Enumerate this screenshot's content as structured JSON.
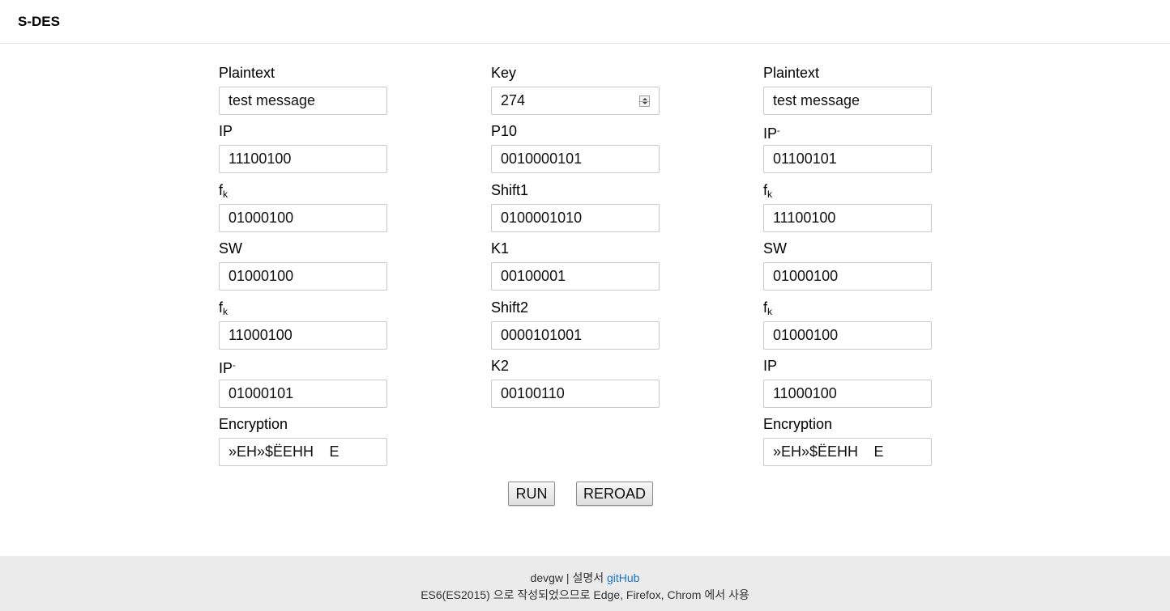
{
  "header": {
    "title": "S-DES"
  },
  "encrypt": {
    "plaintext_label": "Plaintext",
    "plaintext_value": "test message",
    "ip_label": "IP",
    "ip_value": "11100100",
    "fk1_label": "f",
    "fk1_sub": "k",
    "fk1_value": "01000100",
    "sw_label": "SW",
    "sw_value": "01000100",
    "fk2_label": "f",
    "fk2_sub": "k",
    "fk2_value": "11000100",
    "ipinv_label": "IP",
    "ipinv_sup": "-",
    "ipinv_value": "01000101",
    "result_label": "Encryption",
    "result_value": "»EH»$ËEHH E"
  },
  "key": {
    "key_label": "Key",
    "key_value": "274",
    "p10_label": "P10",
    "p10_value": "0010000101",
    "shift1_label": "Shift1",
    "shift1_value": "0100001010",
    "k1_label": "K1",
    "k1_value": "00100001",
    "shift2_label": "Shift2",
    "shift2_value": "0000101001",
    "k2_label": "K2",
    "k2_value": "00100110"
  },
  "decrypt": {
    "plaintext_label": "Plaintext",
    "plaintext_value": "test message",
    "ipinv_label": "IP",
    "ipinv_sup": "-",
    "ipinv_value": "01100101",
    "fk1_label": "f",
    "fk1_sub": "k",
    "fk1_value": "11100100",
    "sw_label": "SW",
    "sw_value": "01000100",
    "fk2_label": "f",
    "fk2_sub": "k",
    "fk2_value": "01000100",
    "ip_label": "IP",
    "ip_value": "11000100",
    "result_label": "Encryption",
    "result_value": "»EH»$ËEHH E"
  },
  "buttons": {
    "run": "RUN",
    "reload": "REROAD"
  },
  "footer": {
    "author": "devgw",
    "separator": " | ",
    "docs": "설명서",
    "github": "gitHub",
    "link_color": "#1a73c8",
    "note": "ES6(ES2015) 으로 작성되었으므로 Edge, Firefox, Chrom 에서 사용"
  }
}
